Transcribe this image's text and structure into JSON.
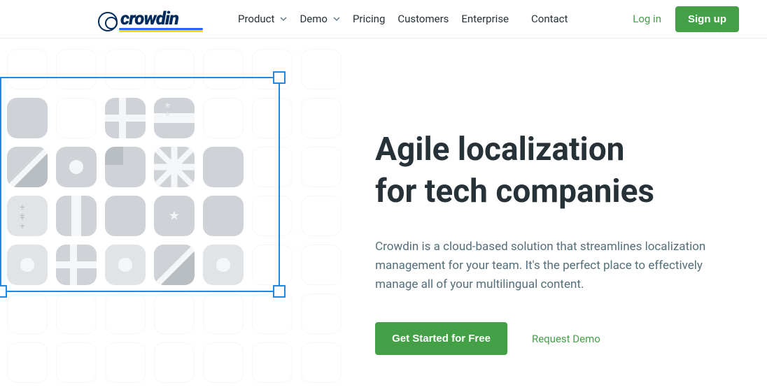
{
  "brand": "crowdin",
  "nav": {
    "product": "Product",
    "demo": "Demo",
    "pricing": "Pricing",
    "customers": "Customers",
    "enterprise": "Enterprise",
    "contact": "Contact"
  },
  "auth": {
    "login": "Log in",
    "signup": "Sign up"
  },
  "hero": {
    "title_line1": "Agile localization",
    "title_line2": "for tech companies",
    "description": "Crowdin is a cloud-based solution that streamlines localization management for your team. It's the perfect place to effectively manage all of your multilingual content.",
    "cta": "Get Started for Free",
    "request_demo": "Request Demo"
  }
}
